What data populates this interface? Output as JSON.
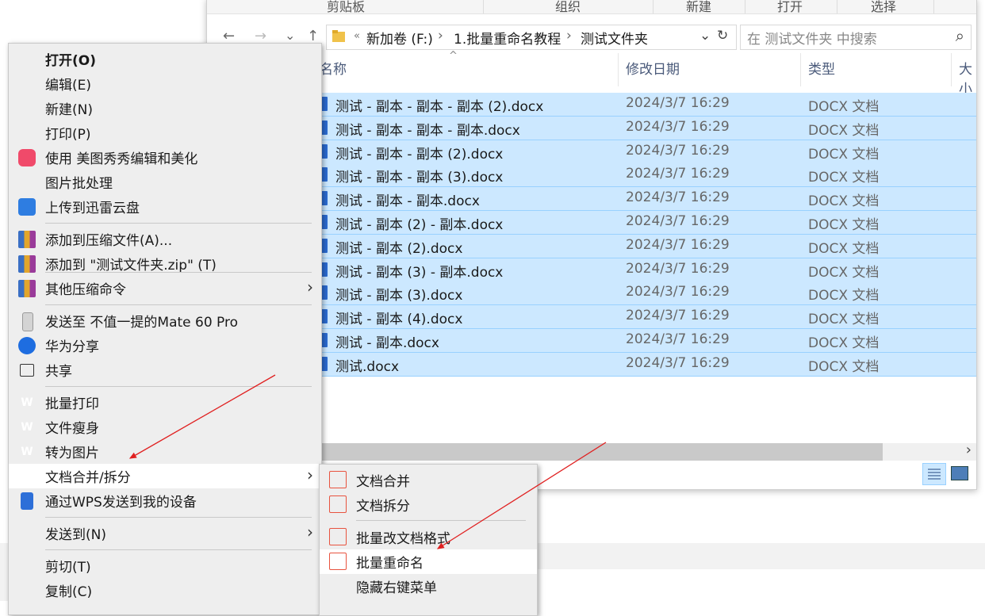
{
  "ribbon": {
    "groups": [
      "剪贴板",
      "组织",
      "新建",
      "打开",
      "选择"
    ]
  },
  "nav": {
    "back": "←",
    "forward": "→",
    "recent": "⌄",
    "up": "↑",
    "breadcrumb": [
      "«",
      "新加卷 (F:)",
      "›",
      "1.批量重命名教程",
      "›",
      "测试文件夹"
    ],
    "dropdown": "⌄",
    "refresh": "↻",
    "search_placeholder": "在 测试文件夹 中搜索",
    "search_icon": "⌕"
  },
  "columns": {
    "sort_caret": "^",
    "name": "名称",
    "date": "修改日期",
    "type": "类型",
    "size": "大小"
  },
  "files": [
    {
      "name": "测试 - 副本 - 副本 - 副本 (2).docx",
      "date": "2024/3/7 16:29",
      "type": "DOCX 文档"
    },
    {
      "name": "测试 - 副本 - 副本 - 副本.docx",
      "date": "2024/3/7 16:29",
      "type": "DOCX 文档"
    },
    {
      "name": "测试 - 副本 - 副本 (2).docx",
      "date": "2024/3/7 16:29",
      "type": "DOCX 文档"
    },
    {
      "name": "测试 - 副本 - 副本 (3).docx",
      "date": "2024/3/7 16:29",
      "type": "DOCX 文档"
    },
    {
      "name": "测试 - 副本 - 副本.docx",
      "date": "2024/3/7 16:29",
      "type": "DOCX 文档"
    },
    {
      "name": "测试 - 副本 (2) - 副本.docx",
      "date": "2024/3/7 16:29",
      "type": "DOCX 文档"
    },
    {
      "name": "测试 - 副本 (2).docx",
      "date": "2024/3/7 16:29",
      "type": "DOCX 文档"
    },
    {
      "name": "测试 - 副本 (3) - 副本.docx",
      "date": "2024/3/7 16:29",
      "type": "DOCX 文档"
    },
    {
      "name": "测试 - 副本 (3).docx",
      "date": "2024/3/7 16:29",
      "type": "DOCX 文档"
    },
    {
      "name": "测试 - 副本 (4).docx",
      "date": "2024/3/7 16:29",
      "type": "DOCX 文档"
    },
    {
      "name": "测试 - 副本.docx",
      "date": "2024/3/7 16:29",
      "type": "DOCX 文档"
    },
    {
      "name": "测试.docx",
      "date": "2024/3/7 16:29",
      "type": "DOCX 文档"
    }
  ],
  "scroll_right": "›",
  "context_menu": {
    "items": [
      {
        "label": "打开(O)",
        "icon": ""
      },
      {
        "label": "编辑(E)",
        "icon": ""
      },
      {
        "label": "新建(N)",
        "icon": ""
      },
      {
        "label": "打印(P)",
        "icon": ""
      },
      {
        "label": "使用 美图秀秀编辑和美化",
        "icon": "meitu-icon"
      },
      {
        "label": "图片批处理",
        "icon": ""
      },
      {
        "label": "上传到迅雷云盘",
        "icon": "xunlei-icon"
      },
      {
        "label": "添加到压缩文件(A)...",
        "icon": "winrar-icon"
      },
      {
        "label": "添加到 \"测试文件夹.zip\" (T)",
        "icon": "winrar-icon"
      },
      {
        "label": "其他压缩命令",
        "icon": "winrar-icon",
        "arrow": "›"
      },
      {
        "label": "发送至 不值一提的Mate 60 Pro",
        "icon": "phone-icon"
      },
      {
        "label": "华为分享",
        "icon": "huawei-share-icon"
      },
      {
        "label": "共享",
        "icon": "share-icon"
      },
      {
        "label": "批量打印",
        "icon": "wps-icon"
      },
      {
        "label": "文件瘦身",
        "icon": "wps-icon"
      },
      {
        "label": "转为图片",
        "icon": "wps-icon"
      },
      {
        "label": "文档合并/拆分",
        "icon": "wps-icon",
        "arrow": "›"
      },
      {
        "label": "通过WPS发送到我的设备",
        "icon": "device-icon"
      },
      {
        "label": "发送到(N)",
        "icon": "",
        "arrow": "›"
      },
      {
        "label": "剪切(T)",
        "icon": ""
      },
      {
        "label": "复制(C)",
        "icon": ""
      }
    ],
    "wps_glyph": "W"
  },
  "submenu": {
    "items": [
      {
        "label": "文档合并",
        "icon": "merge-doc-icon"
      },
      {
        "label": "文档拆分",
        "icon": "split-doc-icon"
      },
      {
        "label": "批量改文档格式",
        "icon": "convert-format-icon"
      },
      {
        "label": "批量重命名",
        "icon": "rename-icon"
      },
      {
        "label": "隐藏右键菜单",
        "icon": ""
      }
    ]
  },
  "colors": {
    "selection": "#cce8ff",
    "wps_red": "#e8352b",
    "arrow_red": "#e02020"
  }
}
